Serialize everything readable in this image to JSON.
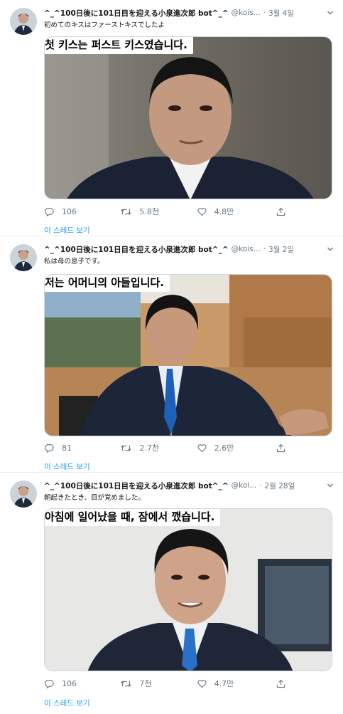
{
  "tweets": [
    {
      "author": "^_^100日後に101日目を迎える小泉進次郎 bot^_^",
      "handle": "@kois...",
      "date": "3월 4일",
      "text": "初めてのキスはファーストキスでしたよ",
      "caption": "첫 키스는 퍼스트 키스였습니다.",
      "replies": "106",
      "retweets": "5.8천",
      "likes": "4.8만",
      "thread_link": "이 스레드 보기"
    },
    {
      "author": "^_^100日後に101日目を迎える小泉進次郎 bot^_^",
      "handle": "@kois...",
      "date": "3월 2일",
      "text": "私は母の息子です。",
      "caption": "저는 어머니의 아들입니다.",
      "replies": "81",
      "retweets": "2.7천",
      "likes": "2.6만",
      "thread_link": "이 스레드 보기"
    },
    {
      "author": "^_^100日後に101日目を迎える小泉進次郎 bot^_^",
      "handle": "@koi...",
      "date": "2월 28일",
      "text": "朝起きたとき、目が覚めました。",
      "caption": "아침에 일어났을 때, 잠에서 깼습니다.",
      "replies": "106",
      "retweets": "7천",
      "likes": "4.7만",
      "thread_link": "이 스레드 보기"
    }
  ],
  "icons": {
    "reply": "reply-icon",
    "retweet": "retweet-icon",
    "like": "heart-icon",
    "share": "share-icon",
    "more": "chevron-down-icon"
  },
  "colors": {
    "link": "#1da1f2",
    "muted": "#657786",
    "divider": "#e6ecf0"
  }
}
